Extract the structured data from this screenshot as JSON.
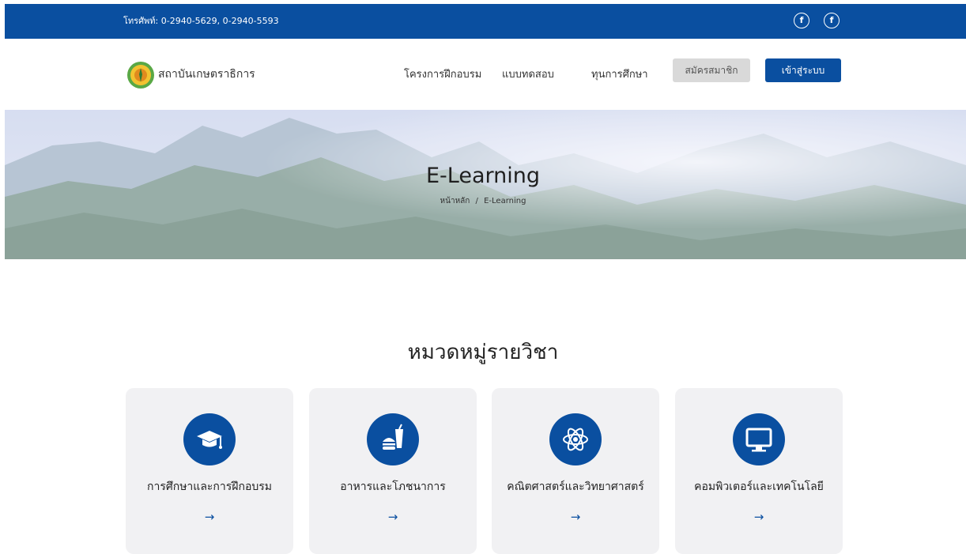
{
  "topbar": {
    "phone": "โทรศัพท์: 0-2940-5629, 0-2940-5593",
    "social_icons": [
      "facebook-icon",
      "facebook-icon"
    ],
    "background": "#0a4fa0"
  },
  "brand": {
    "name": "สถาบันเกษตราธิการ"
  },
  "nav": {
    "items": [
      "โครงการฝึกอบรม",
      "แบบทดสอบ",
      "ทุนการศึกษา"
    ],
    "register_label": "สมัครสมาชิก",
    "login_label": "เข้าสู่ระบบ"
  },
  "hero": {
    "title": "E-Learning",
    "breadcrumb": {
      "home": "หน้าหลัก",
      "sep": "/",
      "current": "E-Learning"
    }
  },
  "section": {
    "title": "หมวดหมู่รายวิชา"
  },
  "categories": [
    {
      "title": "การศึกษาและการฝึกอบรม",
      "icon": "graduation-cap-icon",
      "arrow": "→"
    },
    {
      "title": "อาหารและโภชนาการ",
      "icon": "food-drink-icon",
      "arrow": "→"
    },
    {
      "title": "คณิตศาสตร์และวิทยาศาสตร์",
      "icon": "atom-icon",
      "arrow": "→"
    },
    {
      "title": "คอมพิวเตอร์และเทคโนโลยี",
      "icon": "monitor-icon",
      "arrow": "→"
    }
  ],
  "colors": {
    "primary": "#0a4fa0",
    "register_button": "#d9d9d9",
    "card_bg": "#f1f1f3"
  }
}
